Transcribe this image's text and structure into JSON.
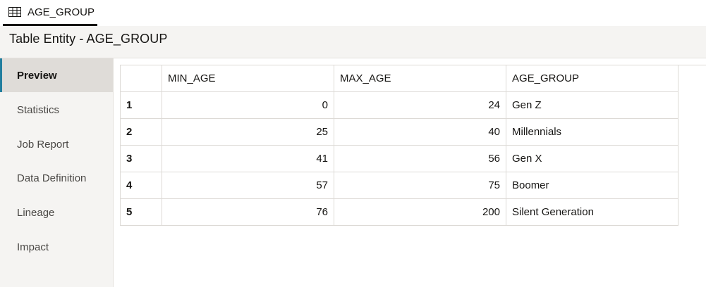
{
  "tab": {
    "label": "AGE_GROUP",
    "icon": "table-icon"
  },
  "header": {
    "title": "Table Entity - AGE_GROUP"
  },
  "sidebar": {
    "items": [
      {
        "label": "Preview",
        "active": true
      },
      {
        "label": "Statistics",
        "active": false
      },
      {
        "label": "Job Report",
        "active": false
      },
      {
        "label": "Data Definition",
        "active": false
      },
      {
        "label": "Lineage",
        "active": false
      },
      {
        "label": "Impact",
        "active": false
      }
    ]
  },
  "grid": {
    "columns": [
      "MIN_AGE",
      "MAX_AGE",
      "AGE_GROUP"
    ],
    "rows": [
      {
        "num": "1",
        "min_age": "0",
        "max_age": "24",
        "age_group": "Gen Z"
      },
      {
        "num": "2",
        "min_age": "25",
        "max_age": "40",
        "age_group": "Millennials"
      },
      {
        "num": "3",
        "min_age": "41",
        "max_age": "56",
        "age_group": "Gen X"
      },
      {
        "num": "4",
        "min_age": "57",
        "max_age": "75",
        "age_group": "Boomer"
      },
      {
        "num": "5",
        "min_age": "76",
        "max_age": "200",
        "age_group": "Silent Generation"
      }
    ]
  },
  "colors": {
    "accent": "#227e9e",
    "panel_bg": "#f5f4f2",
    "active_bg": "#dfdcd8"
  }
}
